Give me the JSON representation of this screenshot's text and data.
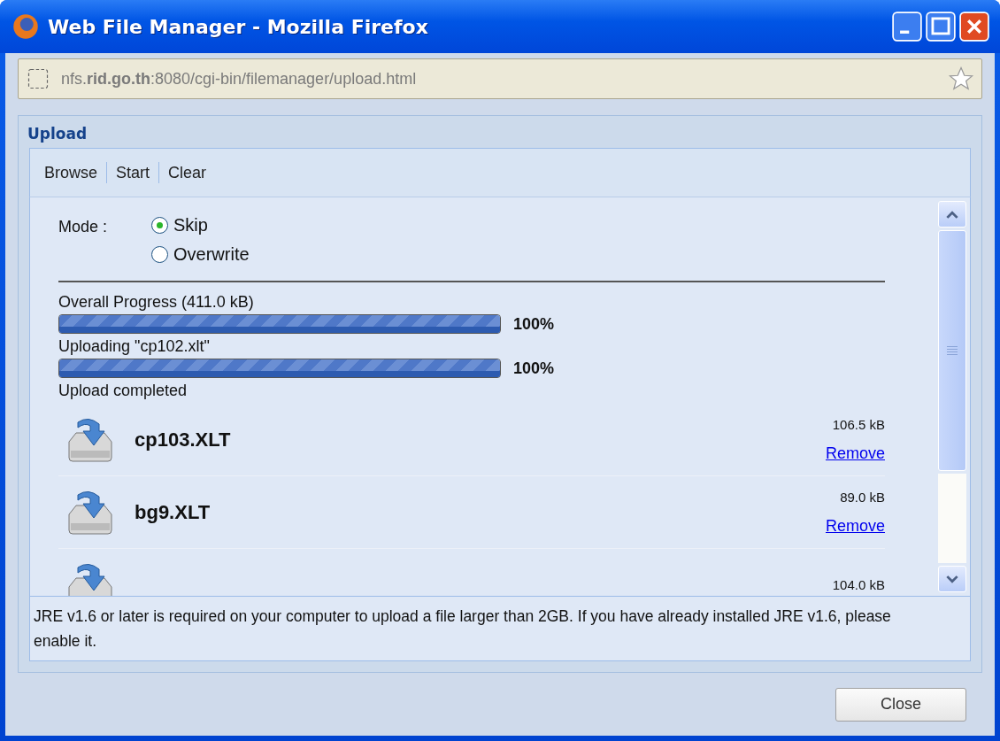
{
  "window": {
    "title": "Web File Manager - Mozilla Firefox"
  },
  "address_bar": {
    "url": "nfs.**rid.go.th**:8080/cgi-bin/filemanager/upload.html"
  },
  "panel": {
    "title": "Upload"
  },
  "toolbar": [
    "Browse",
    "Start",
    "Clear"
  ],
  "mode": {
    "label": "Mode :",
    "options": [
      {
        "label": "Skip",
        "selected": true
      },
      {
        "label": "Overwrite",
        "selected": false
      }
    ]
  },
  "progress": [
    {
      "label": "Overall Progress (411.0 kB)",
      "level": 1.0,
      "percent": "100%"
    },
    {
      "label": "Uploading \"cp102.xlt\"",
      "level": 1.0,
      "percent": "100%"
    }
  ],
  "status": "Upload completed",
  "files": [
    {
      "name": "cp103.XLT",
      "size": "106.5 kB",
      "action": "Remove"
    },
    {
      "name": "bg9.XLT",
      "size": "89.0 kB",
      "action": "Remove"
    },
    {
      "size": "104.0 kB"
    }
  ],
  "message": "JRE v1.6 or later is required on your computer to upload a file larger than 2GB. If you have already installed JRE v1.6, please enable it.",
  "buttons": [
    "Close"
  ]
}
